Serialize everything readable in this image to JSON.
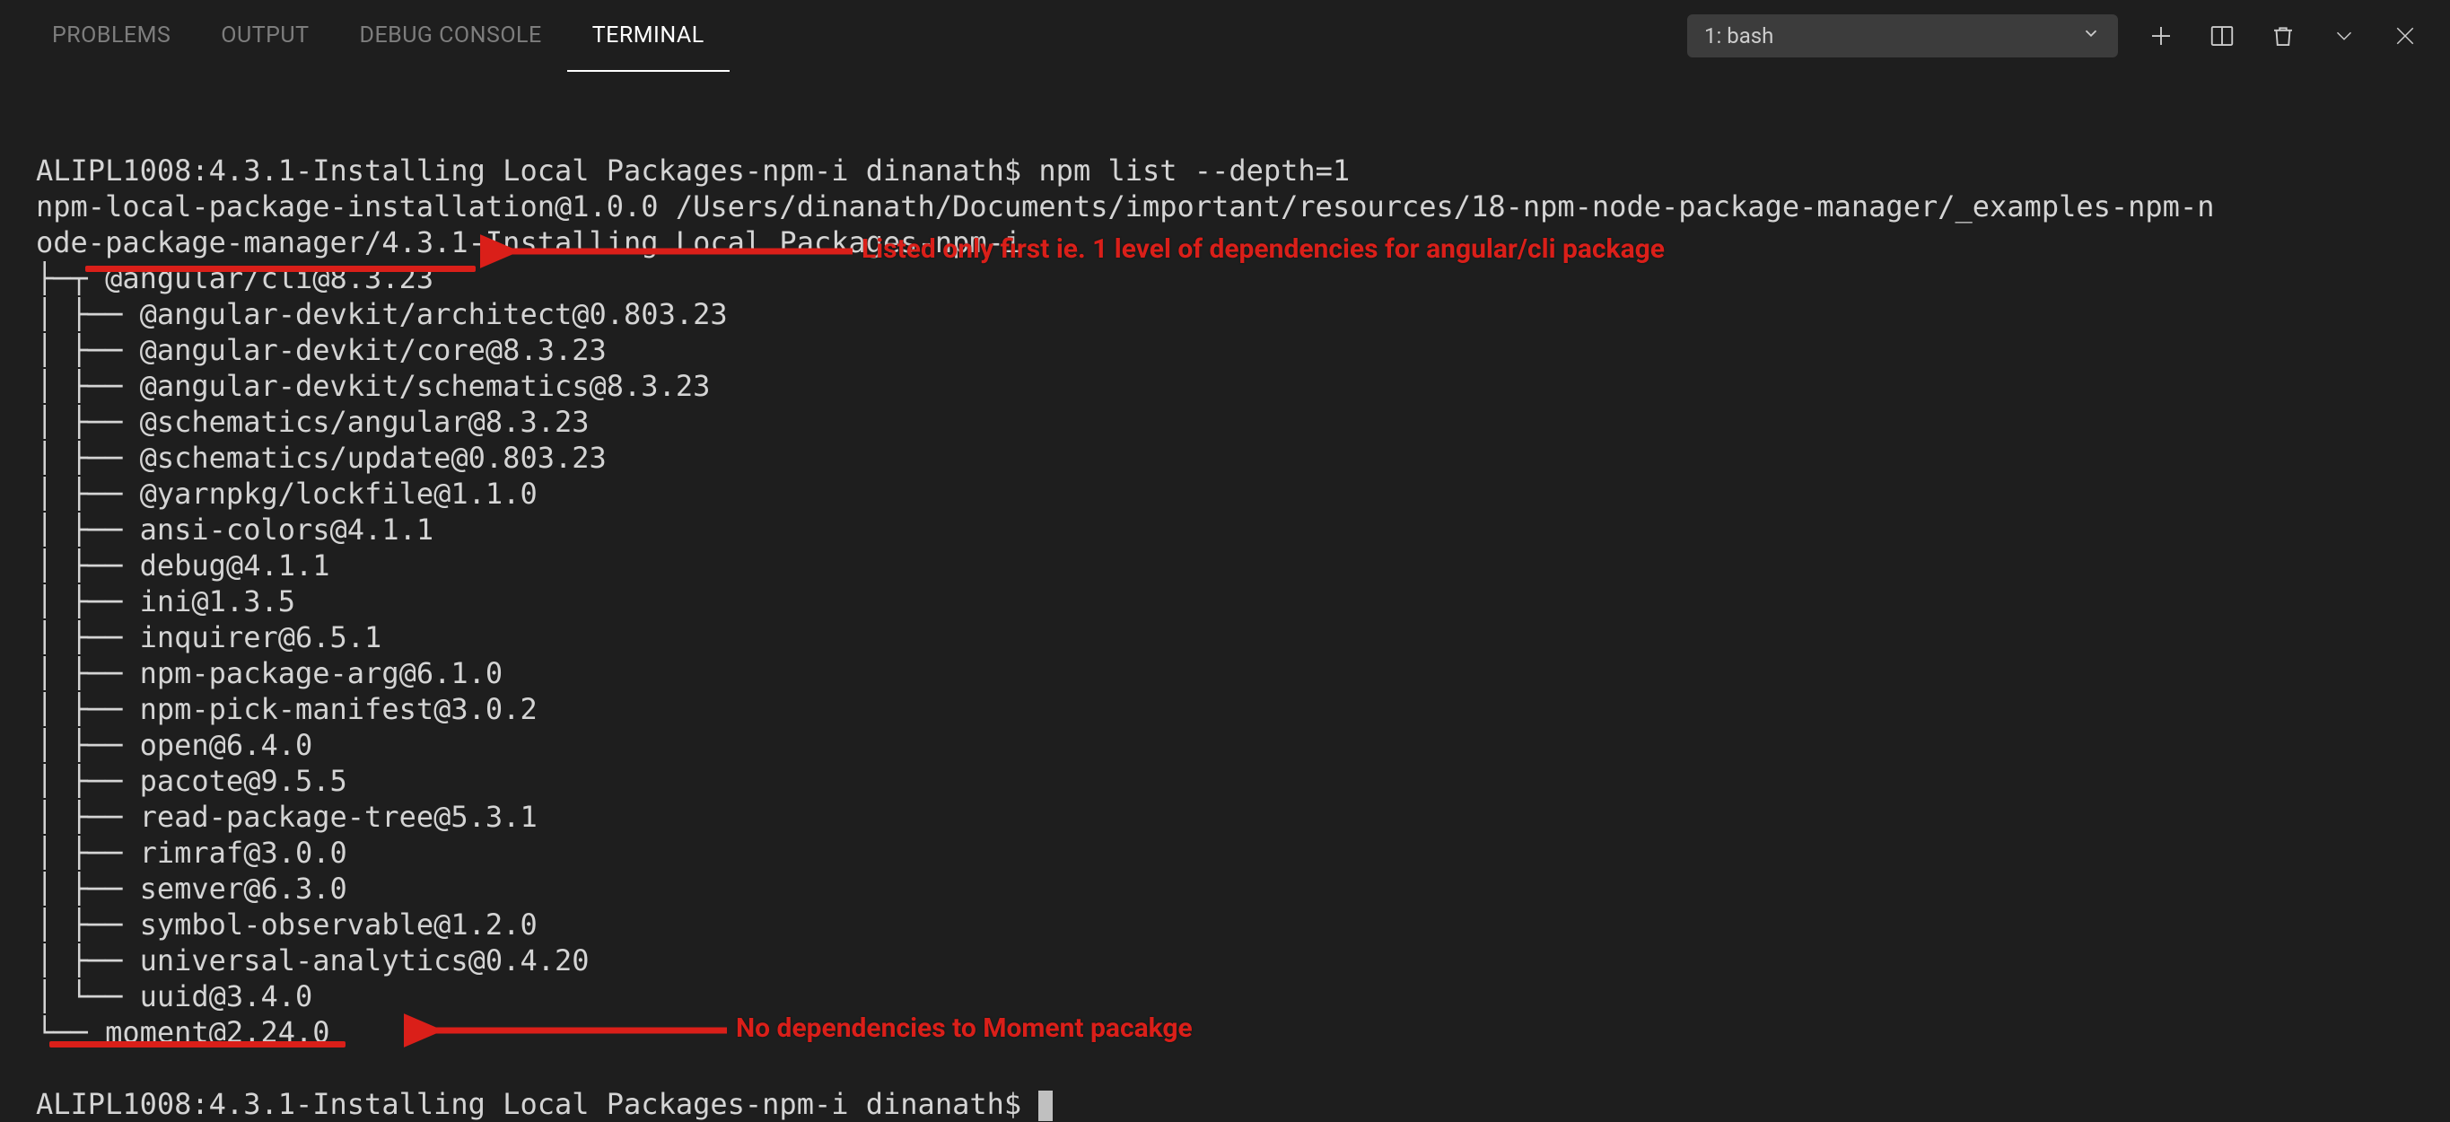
{
  "tabs": {
    "problems": "PROBLEMS",
    "output": "OUTPUT",
    "debug_console": "DEBUG CONSOLE",
    "terminal": "TERMINAL"
  },
  "dropdown": {
    "selected": "1: bash"
  },
  "terminal": {
    "line1": "ALIPL1008:4.3.1-Installing Local Packages-npm-i dinanath$ npm list --depth=1",
    "line2": "npm-local-package-installation@1.0.0 /Users/dinanath/Documents/important/resources/18-npm-node-package-manager/_examples-npm-n",
    "line3": "ode-package-manager/4.3.1-Installing Local Packages-npm-i",
    "line4": "├─┬ @angular/cli@8.3.23",
    "deps": [
      "│ ├── @angular-devkit/architect@0.803.23",
      "│ ├── @angular-devkit/core@8.3.23",
      "│ ├── @angular-devkit/schematics@8.3.23",
      "│ ├── @schematics/angular@8.3.23",
      "│ ├── @schematics/update@0.803.23",
      "│ ├── @yarnpkg/lockfile@1.1.0",
      "│ ├── ansi-colors@4.1.1",
      "│ ├── debug@4.1.1",
      "│ ├── ini@1.3.5",
      "│ ├── inquirer@6.5.1",
      "│ ├── npm-package-arg@6.1.0",
      "│ ├── npm-pick-manifest@3.0.2",
      "│ ├── open@6.4.0",
      "│ ├── pacote@9.5.5",
      "│ ├── read-package-tree@5.3.1",
      "│ ├── rimraf@3.0.0",
      "│ ├── semver@6.3.0",
      "│ ├── symbol-observable@1.2.0",
      "│ ├── universal-analytics@0.4.20",
      "│ └── uuid@3.4.0"
    ],
    "line_moment": "└── moment@2.24.0",
    "prompt": "ALIPL1008:4.3.1-Installing Local Packages-npm-i dinanath$ "
  },
  "annotations": {
    "top": "Listed only first ie. 1 level of dependencies for angular/cli package",
    "bottom": "No dependencies to Moment pacakge"
  }
}
